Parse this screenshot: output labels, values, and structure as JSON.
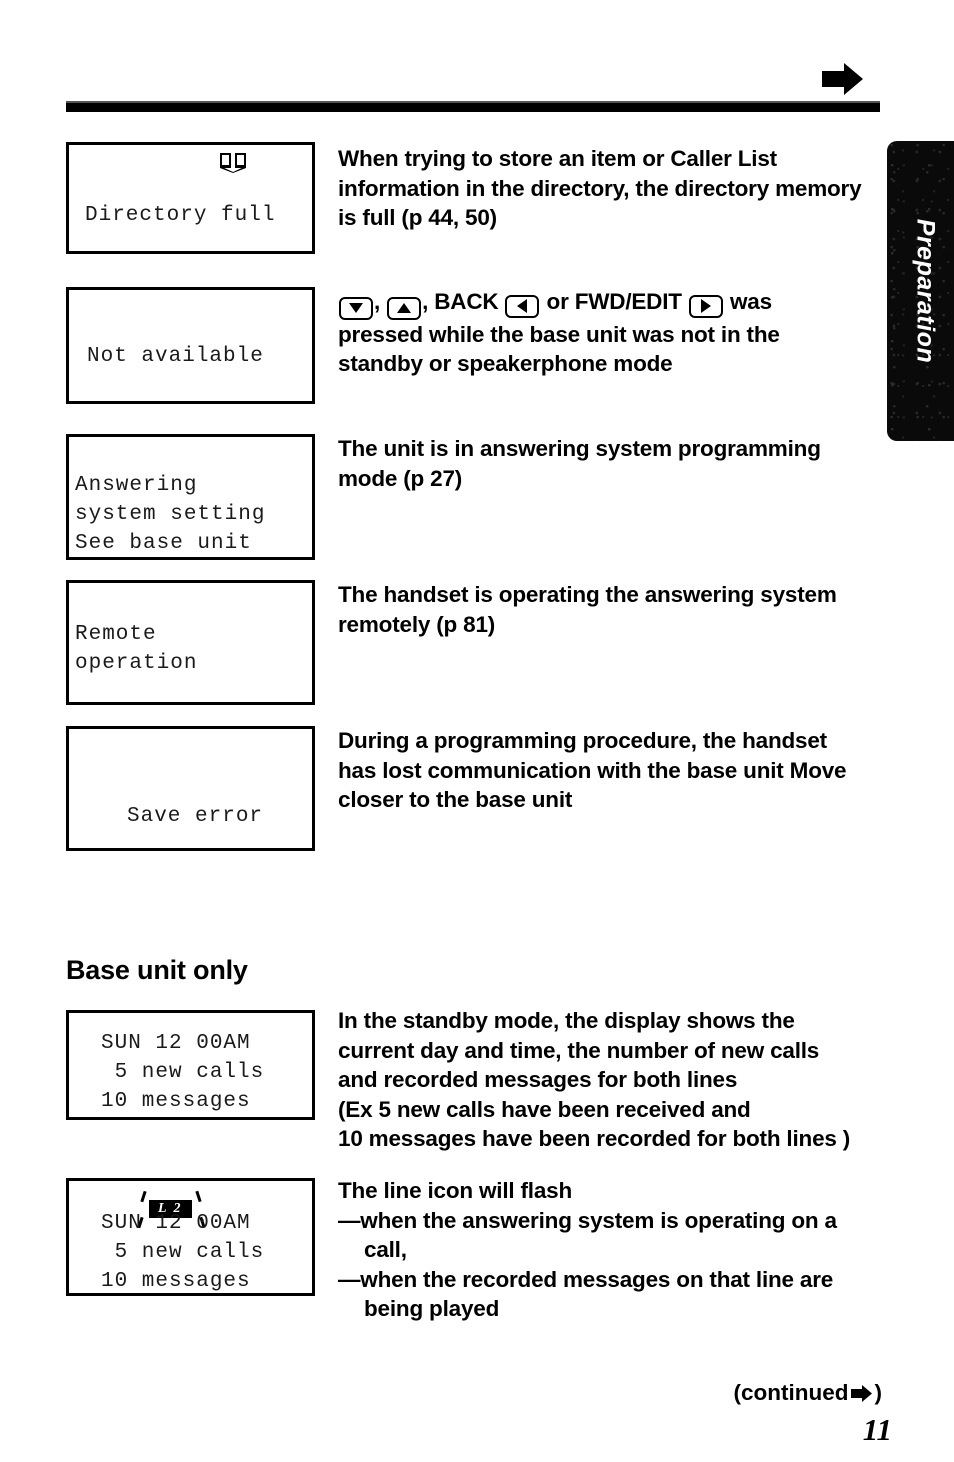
{
  "page": {
    "number": "11",
    "continued_label": "(continued",
    "continued_close": ")",
    "side_tab_label": "Preparation"
  },
  "icons": {
    "top_arrow": "right-arrow-icon",
    "book": "open-book-icon",
    "continued_arrow": "right-arrow-icon"
  },
  "entries": [
    {
      "lcd": {
        "has_book_icon": true,
        "lines": [
          "",
          "Directory full"
        ]
      },
      "desc_lines": [
        "When trying to store an item or Caller List",
        "information in the directory, the directory memory",
        "is full (p  44, 50)"
      ]
    },
    {
      "lcd": {
        "has_book_icon": false,
        "lines": [
          "Not available"
        ]
      },
      "keys": {
        "down": "down-arrow-key",
        "up": "up-arrow-key",
        "back_label": "BACK",
        "back": "left-arrow-key",
        "fwd_label": "FWD/EDIT",
        "fwd": "right-arrow-key"
      },
      "desc_lines": [
        "was",
        "pressed while the base unit was not in the",
        "standby or speakerphone mode"
      ]
    },
    {
      "lcd": {
        "has_book_icon": false,
        "lines": [
          "Answering",
          "system setting",
          "See base unit"
        ]
      },
      "desc_lines": [
        "The unit is in answering system programming",
        "mode (p  27)"
      ]
    },
    {
      "lcd": {
        "has_book_icon": false,
        "lines": [
          "Remote",
          "operation"
        ]
      },
      "desc_lines": [
        "The handset is operating the answering system",
        "remotely (p  81)"
      ]
    },
    {
      "lcd": {
        "has_book_icon": false,
        "lines": [
          "Save error"
        ]
      },
      "desc_lines": [
        "During a programming procedure, the handset",
        "has lost communication with the base unit  Move",
        "closer to the base unit"
      ]
    }
  ],
  "base_unit_section": {
    "heading": "Base unit only",
    "entries": [
      {
        "lcd": {
          "lines": [
            "SUN 12 00AM",
            " 5 new calls",
            "10 messages"
          ],
          "has_l2": false
        },
        "desc_lines": [
          "In the standby mode, the display shows the",
          "current day and time, the number of new calls",
          "and recorded messages for both lines",
          "(Ex  5 new calls have been received and",
          "10 messages have been recorded for both lines )"
        ]
      },
      {
        "lcd": {
          "lines": [
            "SUN 12 00AM",
            " 5 new calls",
            "10 messages"
          ],
          "has_l2": true,
          "l2_label": "L 2"
        },
        "desc_lines": [
          "The line icon will flash",
          "—when the answering system is operating on a",
          "call,",
          "—when the recorded messages on that line are",
          "being played"
        ]
      }
    ]
  }
}
